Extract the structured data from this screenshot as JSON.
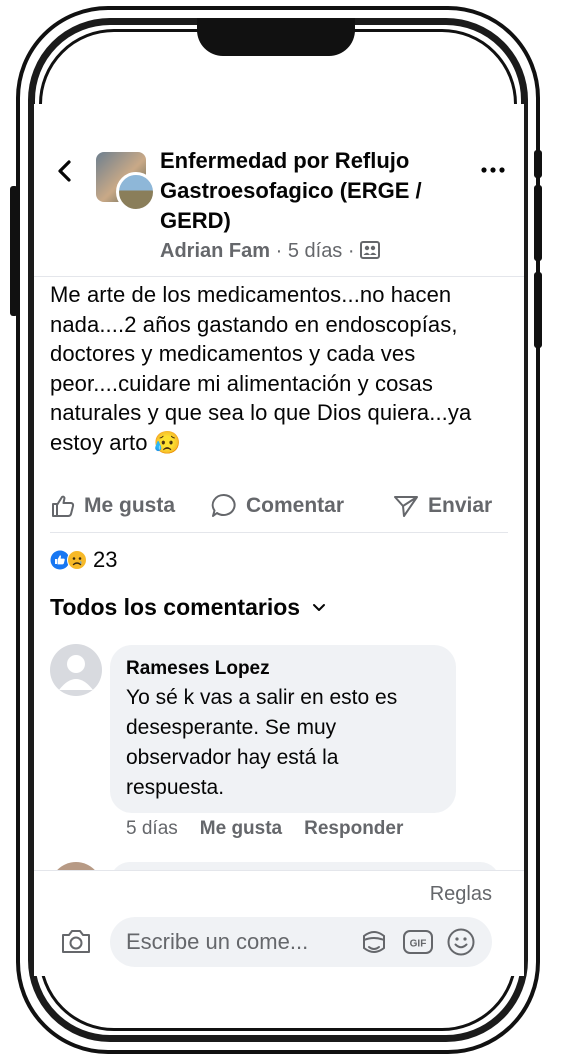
{
  "header": {
    "group_title": "Enfermedad por Reflujo Gastroesofagico (ERGE / GERD)",
    "author": "Adrian Fam",
    "time": "5 días",
    "sep": "·",
    "icons": {
      "back": "chevron-left-icon",
      "more": "ellipsis-icon",
      "audience": "group-audience-icon"
    }
  },
  "post": {
    "text": "Me arte de los medicamentos...no hacen nada....2 años gastando en endoscopías, doctores y medicamentos y cada ves peor....cuidare mi alimentación y cosas naturales y que sea lo que Dios quiera...ya estoy arto 😥"
  },
  "actions": {
    "like": "Me gusta",
    "comment": "Comentar",
    "send": "Enviar"
  },
  "reactions": {
    "count": "23",
    "types": [
      "like",
      "sad"
    ],
    "colors": {
      "like": "#1877f2",
      "sad": "#f7b928"
    }
  },
  "comments": {
    "header": "Todos los comentarios",
    "items": [
      {
        "name": "Rameses Lopez",
        "text": "Yo sé k vas a salir en esto es desesperante. Se muy observador hay está la respuesta.",
        "time": "5 días",
        "like": "Me gusta",
        "reply": "Responder"
      }
    ]
  },
  "composer": {
    "rules": "Reglas",
    "placeholder": "Escribe un come..."
  }
}
